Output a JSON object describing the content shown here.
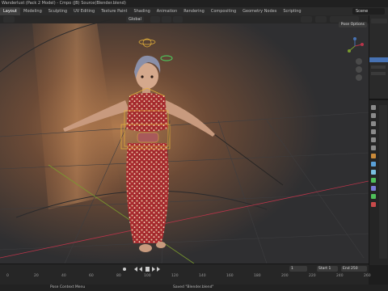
{
  "title": "Wanderlust (Pack 2 Model) - Cmpo (JB) Source(Blender.blend)",
  "workspaces": [
    "Layout",
    "Modeling",
    "Sculpting",
    "UV Editing",
    "Texture Paint",
    "Shading",
    "Animation",
    "Rendering",
    "Compositing",
    "Geometry Nodes",
    "Scripting"
  ],
  "scene_label": "Scene",
  "viewport": {
    "orientation": "Global",
    "pose_options": "Pose Options"
  },
  "timeline": {
    "current_frame": "1",
    "start_label": "Start",
    "start_value": "1",
    "end_label": "End",
    "end_value": "250",
    "ruler": [
      "0",
      "20",
      "40",
      "60",
      "80",
      "100",
      "120",
      "140",
      "160",
      "180",
      "200",
      "220",
      "240",
      "260"
    ]
  },
  "status": {
    "context_menu": "Pose Context Menu",
    "saved_message": "Saved \"Blender.blend\""
  },
  "colors": {
    "accent": "#4772b3",
    "bone_select": "#e6b23a",
    "x_axis": "#b8354a",
    "y_axis": "#7a9b2e"
  }
}
